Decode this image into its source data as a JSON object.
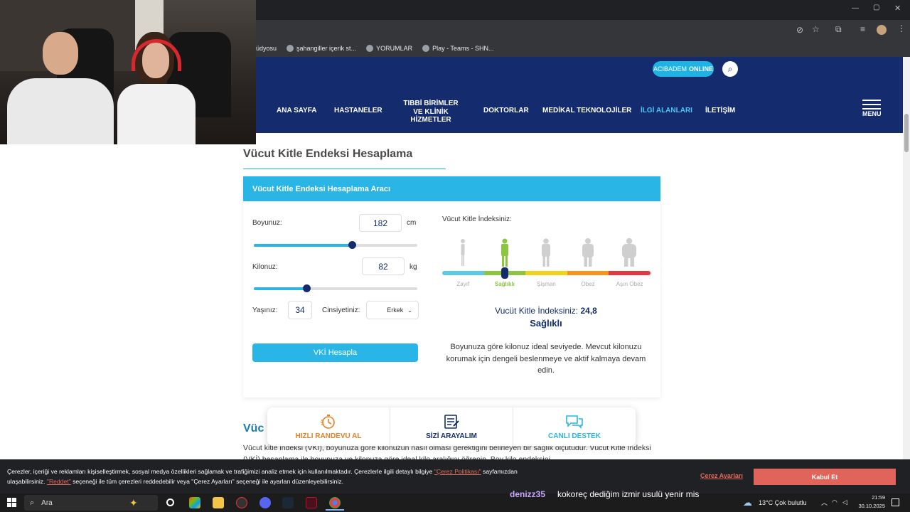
{
  "browser": {
    "bookmarks": [
      {
        "label": "üdyosu"
      },
      {
        "label": "şahangiller içerik st..."
      },
      {
        "label": "YORUMLAR"
      },
      {
        "label": "Play - Teams - SHN..."
      }
    ]
  },
  "header": {
    "online_badge": {
      "prefix": "ACIBADEM",
      "suffix": "ONLINE"
    },
    "nav": [
      {
        "label": "ANA SAYFA"
      },
      {
        "label": "HASTANELER"
      },
      {
        "label": "TIBBİ BİRİMLER\nVE KLİNİK HİZMETLER"
      },
      {
        "label": "DOKTORLAR"
      },
      {
        "label": "MEDİKAL TEKNOLOJİLER"
      },
      {
        "label": "İLGİ ALANLARI"
      },
      {
        "label": "İLETİŞİM"
      }
    ],
    "menu_label": "MENU",
    "active_nav_color": "#4fc3f7"
  },
  "page": {
    "title": "Vücut Kitle Endeksi Hesaplama"
  },
  "calculator": {
    "header": "Vücut Kitle Endeksi Hesaplama Aracı",
    "height_label": "Boyunuz:",
    "height_value": "182",
    "height_unit": "cm",
    "height_slider": 0.6,
    "weight_label": "Kilonuz:",
    "weight_value": "82",
    "weight_unit": "kg",
    "weight_slider": 0.32,
    "age_label": "Yaşınız:",
    "age_value": "34",
    "gender_label": "Cinsiyetiniz:",
    "gender_value": "Erkek",
    "button_label": "VKİ Hesapla"
  },
  "result": {
    "label": "Vücut Kitle İndeksiniz:",
    "categories": [
      {
        "label": "Zayıf",
        "color": "#5bc8e8",
        "active": false
      },
      {
        "label": "Sağlıklı",
        "color": "#8cc63f",
        "active": true
      },
      {
        "label": "Şişman",
        "color": "#f2d21b",
        "active": false
      },
      {
        "label": "Obez",
        "color": "#f7941d",
        "active": false
      },
      {
        "label": "Aşırı Obez",
        "color": "#e2373f",
        "active": false
      }
    ],
    "value_label": "Vucüt Kitle İndeksiniz:",
    "value": "24,8",
    "status": "Sağlıklı",
    "description": "Boyunuza göre kilonuz ideal seviyede. Mevcut kilonuzu korumak için dengeli beslenmeye ve aktif kalmaya devam edin."
  },
  "actions": [
    {
      "label": "HIZLI RANDEVU AL",
      "color": "#e67e22",
      "icon": "stopwatch-icon"
    },
    {
      "label": "SİZİ ARAYALIM",
      "color": "#142c6e",
      "icon": "form-icon"
    },
    {
      "label": "CANLI DESTEK",
      "color": "#29b6e6",
      "icon": "chat-icon"
    }
  ],
  "info": {
    "title": "Vüc",
    "paragraph": "Vücut kitle indeksi (VKİ), boyunuza göre kilonuzun nasıl olması gerektiğini belirleyen bir sağlık ölçütüdür. Vücut Kitle İndeksi (VKİ) hesaplama ile boyunuza ve kilonuza göre ideal kilo aralığını öğrenin. Boy kilo endeksini"
  },
  "cookie": {
    "text1": "Çerezler, içeriği ve reklamları kişiselleştirmek, sosyal medya özellikleri sağlamak ve trafiğimizi analiz etmek için kullanılmaktadır. Çerezlerle ilgili detaylı bilgiye",
    "policy_link": "\"Çerez Politikası\"",
    "text2": "sayfamızdan",
    "text3": "ulaşabilirsiniz.",
    "reject_link": "\"Reddet\"",
    "text4": "seçeneği ile tüm çerezleri reddedebilir veya \"Çerez Ayarları\" seçeneği ile ayarları düzenleyebilirsiniz.",
    "settings": "Çerez Ayarları",
    "accept": "Kabul Et"
  },
  "chat": {
    "username": "denizz35",
    "message": "kokoreç dediğim izmir usulü yenir mis"
  },
  "taskbar": {
    "search_placeholder": "Ara",
    "weather": "13°C  Çok bulutlu",
    "time": "21:59",
    "date": "30.10.2025"
  }
}
